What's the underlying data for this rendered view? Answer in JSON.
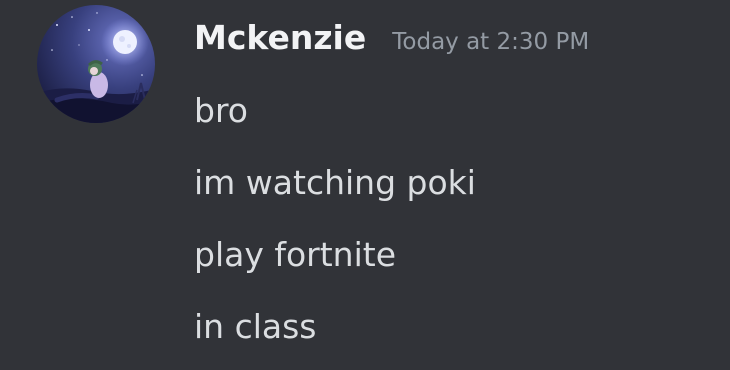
{
  "message": {
    "author": "Mckenzie",
    "timestamp": "Today at 2:30 PM",
    "avatar_icon": "moon-night-avatar",
    "lines": [
      "bro",
      "im watching poki",
      "play fortnite",
      "in class"
    ]
  },
  "colors": {
    "background": "#313338",
    "username": "#f2f3f5",
    "timestamp": "#949ba4",
    "message_text": "#dbdee1"
  }
}
